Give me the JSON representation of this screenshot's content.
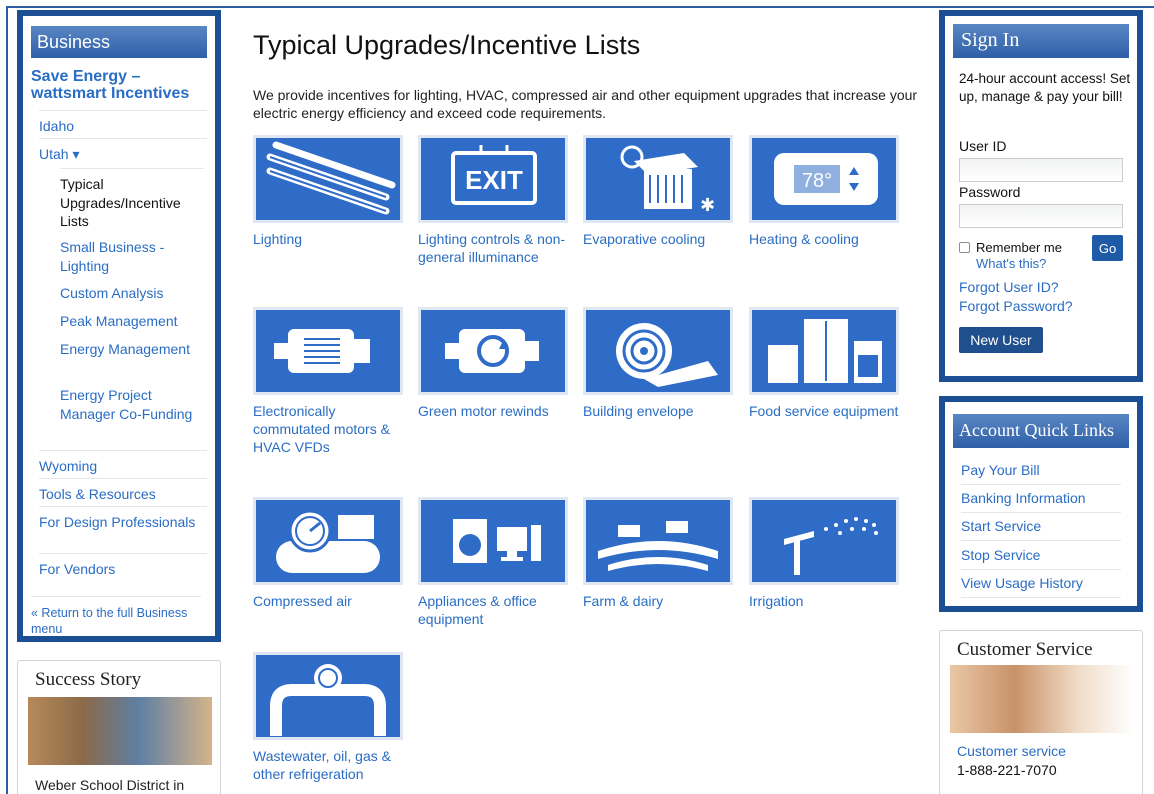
{
  "left_nav": {
    "header": "Business",
    "section_title": "Save Energy – wattsmart Incentives",
    "items": [
      {
        "label": "Idaho"
      },
      {
        "label": "Utah ▾"
      }
    ],
    "sub_items": [
      {
        "label": "Typical Upgrades/Incentive Lists"
      },
      {
        "label": "Small Business - Lighting"
      },
      {
        "label": "Custom Analysis"
      },
      {
        "label": "Peak Management"
      },
      {
        "label": "Energy Management"
      },
      {
        "label": "Energy Project Manager Co-Funding"
      }
    ],
    "items_after": [
      {
        "label": "Wyoming"
      },
      {
        "label": "Tools & Resources"
      },
      {
        "label": "For Design Professionals"
      },
      {
        "label": "For Vendors"
      }
    ],
    "return_link": "« Return to the full Business menu"
  },
  "success_story": {
    "title": "Success Story",
    "text": "Weber School District in"
  },
  "main": {
    "title": "Typical Upgrades/Incentive Lists",
    "intro": "We provide incentives for lighting, HVAC, compressed air and other equipment upgrades that increase your electric energy efficiency and exceed code requirements.",
    "tiles": [
      {
        "label": "Lighting",
        "icon": "fluorescent-tubes-icon"
      },
      {
        "label": "Lighting controls & non-general illuminance",
        "icon": "exit-sign-icon",
        "icon_text": "EXIT"
      },
      {
        "label": "Evaporative cooling",
        "icon": "cooler-icon"
      },
      {
        "label": "Heating & cooling",
        "icon": "thermostat-icon",
        "icon_text": "78°"
      },
      {
        "label": "Electronically commutated motors & HVAC VFDs",
        "icon": "motor-icon"
      },
      {
        "label": "Green motor rewinds",
        "icon": "rewind-motor-icon"
      },
      {
        "label": "Building envelope",
        "icon": "insulation-roll-icon"
      },
      {
        "label": "Food service equipment",
        "icon": "kitchen-appliances-icon"
      },
      {
        "label": "Compressed air",
        "icon": "compressor-icon"
      },
      {
        "label": "Appliances & office equipment",
        "icon": "washer-computer-icon"
      },
      {
        "label": "Farm & dairy",
        "icon": "cows-icon"
      },
      {
        "label": "Irrigation",
        "icon": "sprinkler-icon"
      },
      {
        "label": "Wastewater, oil, gas & other refrigeration",
        "icon": "pipe-gauge-icon"
      }
    ]
  },
  "signin": {
    "header": "Sign In",
    "text": "24-hour account access! Set up, manage & pay your bill!",
    "user_id_label": "User ID",
    "password_label": "Password",
    "remember_label": "Remember me",
    "whats_this": "What's this?",
    "go_label": "Go",
    "forgot_user": "Forgot User ID?",
    "forgot_password": "Forgot Password?",
    "new_user": "New User"
  },
  "quick_links": {
    "header": "Account Quick Links",
    "items": [
      {
        "label": "Pay Your Bill"
      },
      {
        "label": "Banking Information"
      },
      {
        "label": "Start Service"
      },
      {
        "label": "Stop Service"
      },
      {
        "label": "View Usage History"
      }
    ]
  },
  "customer_service": {
    "title": "Customer Service",
    "link": "Customer service",
    "phone": "1-888-221-7070"
  },
  "colors": {
    "brand_blue": "#1c4e94",
    "tile_blue": "#2f6cc8",
    "link_blue": "#2a6dc4"
  }
}
